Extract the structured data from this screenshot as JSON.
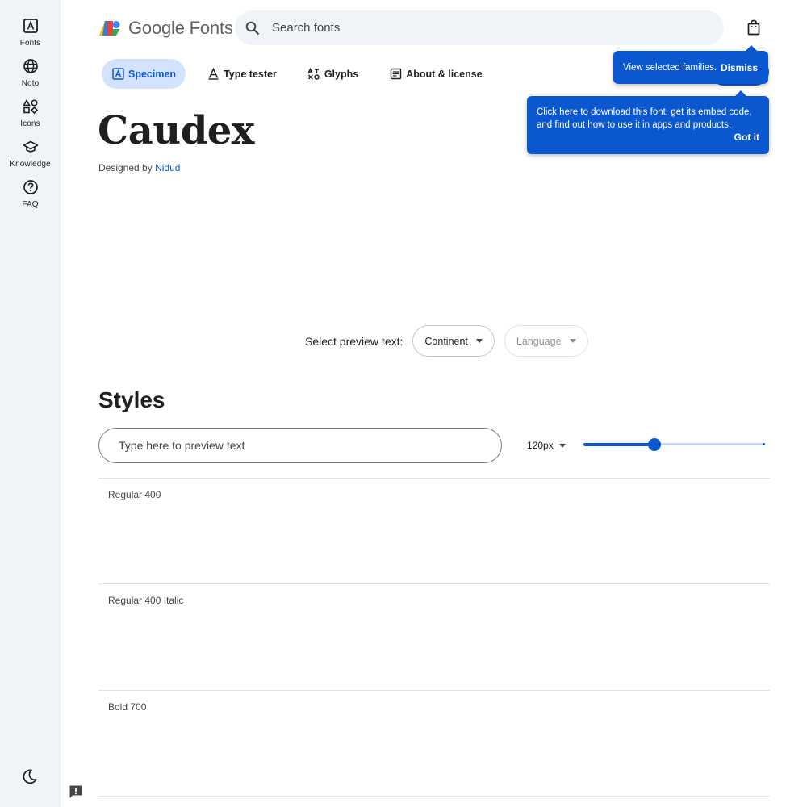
{
  "rail": {
    "items": [
      {
        "label": "Fonts",
        "icon": "fonts-icon"
      },
      {
        "label": "Noto",
        "icon": "globe-icon"
      },
      {
        "label": "Icons",
        "icon": "shapes-icon"
      },
      {
        "label": "Knowledge",
        "icon": "school-icon"
      },
      {
        "label": "FAQ",
        "icon": "help-icon"
      }
    ],
    "bottom_icon": "dark-mode-icon"
  },
  "header": {
    "brand": "Google Fonts",
    "search_placeholder": "Search fonts"
  },
  "tabs": [
    {
      "label": "Specimen",
      "active": true
    },
    {
      "label": "Type tester",
      "active": false
    },
    {
      "label": "Glyphs",
      "active": false
    },
    {
      "label": "About & license",
      "active": false
    }
  ],
  "font": {
    "name": "Caudex",
    "designed_by": "Designed by",
    "designer": "Nidud"
  },
  "preview": {
    "label": "Select preview text:",
    "option": "Continent",
    "language": "Language"
  },
  "styles": {
    "heading": "Styles",
    "input_placeholder": "Type here to preview text",
    "size": "120px",
    "slider_fraction": 0.39,
    "rows": [
      {
        "name": "Regular 400"
      },
      {
        "name": "Regular 400 Italic"
      },
      {
        "name": "Bold 700"
      }
    ]
  },
  "tooltips": {
    "selected_families": "View selected families.",
    "dismiss": "Dismiss",
    "download_text": "Click here to download this font, get its embed code, and find out how to use it in apps and products.",
    "got_it": "Got it"
  },
  "colors": {
    "accent": "#0b57d0",
    "rail_bg": "#f0f4f9",
    "tab_active_bg": "#d3e3fd"
  }
}
